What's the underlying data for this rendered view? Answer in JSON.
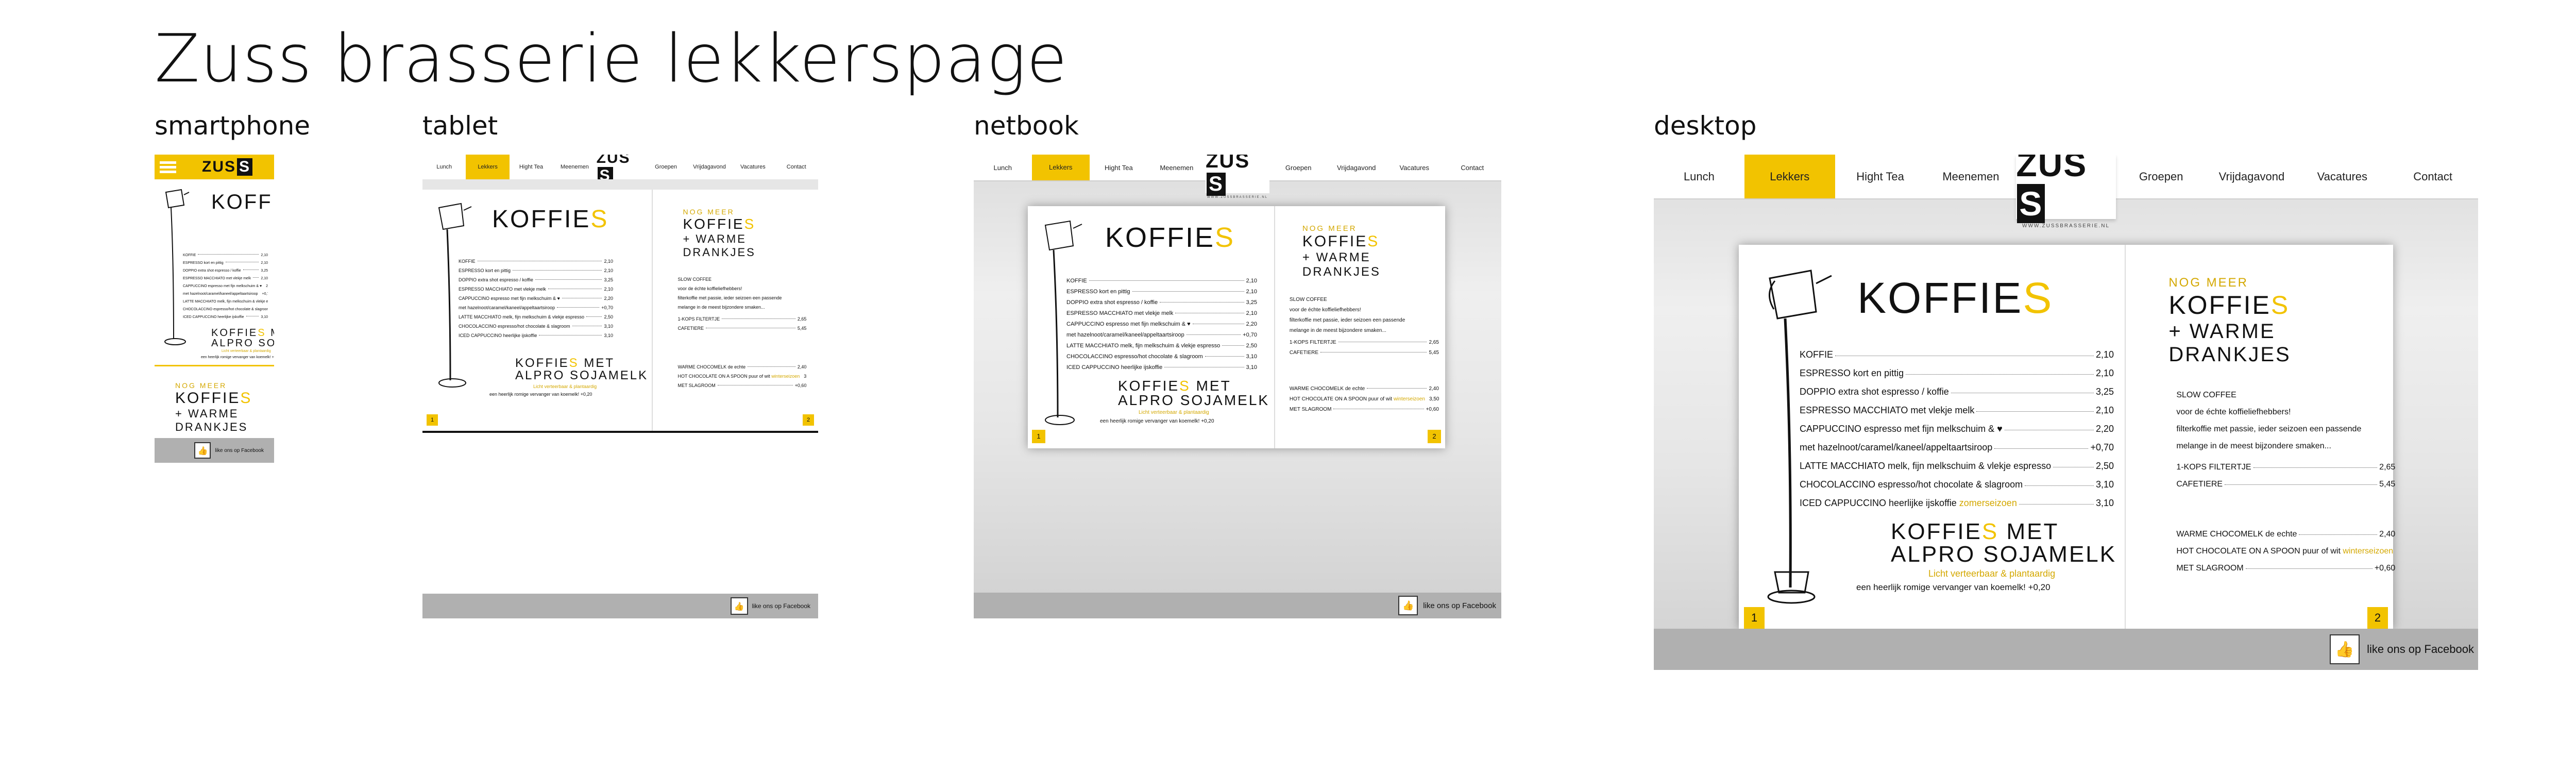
{
  "title": "Zuss brasserie lekkerspage",
  "labels": {
    "smartphone": "smartphone",
    "tablet": "tablet",
    "netbook": "netbook",
    "desktop": "desktop"
  },
  "nav": {
    "items": [
      "Lunch",
      "Lekkers",
      "Hight Tea",
      "Meenemen",
      "Groepen",
      "Vrijdagavond",
      "Vacatures",
      "Contact"
    ],
    "active": "Lekkers"
  },
  "logo": {
    "text": "ZUS",
    "mark": "S",
    "sub": "WWW.ZUSSBRASSERIE.NL"
  },
  "menu": {
    "koffie_heading_a": "KOFFIE",
    "koffie_heading_b": "S",
    "items": [
      {
        "name": "KOFFIE",
        "price": "2,10"
      },
      {
        "name": "ESPRESSO kort en pittig",
        "price": "2,10"
      },
      {
        "name": "DOPPIO extra shot espresso / koffie",
        "price": "3,25"
      },
      {
        "name": "ESPRESSO MACCHIATO met vlekje melk",
        "price": "2,10"
      },
      {
        "name": "CAPPUCCINO espresso met fijn melkschuim & ♥",
        "price": "2,20"
      },
      {
        "name": "met hazelnoot/caramel/kaneel/appeltaartsiroop",
        "price": "+0,70"
      },
      {
        "name": "LATTE MACCHIATO melk, fijn melkschuim & vlekje espresso",
        "price": "2,50"
      },
      {
        "name": "CHOCOLACCINO espresso/hot chocolate & slagroom",
        "price": "3,10"
      },
      {
        "name": "ICED CAPPUCCINO heerlijke ijskoffie",
        "price": "3,10",
        "extra": "zomerseizoen"
      }
    ],
    "alpro_heading_1a": "KOFFIE",
    "alpro_heading_1b": "S",
    "alpro_heading_1c": " MET",
    "alpro_heading_2": "ALPRO SOJAMELK",
    "alpro_sub": "Licht verteerbaar & plantaardig",
    "alpro_line": "een heerlijk romige vervanger van koemelk!",
    "alpro_price": "+0,20",
    "right_heading_1": "NOG MEER",
    "right_heading_2a": "KOFFIE",
    "right_heading_2b": "S",
    "right_heading_3": "+ WARME",
    "right_heading_4": "DRANKJES",
    "slow_title": "SLOW COFFEE",
    "slow_lines": [
      "voor de échte koffieliefhebbers!",
      "filterkoffie met passie, ieder seizoen een passende",
      "melange in de meest bijzondere smaken..."
    ],
    "right_items_a": [
      {
        "name": "1-KOPS FILTERTJE",
        "price": "2,65"
      },
      {
        "name": "CAFETIERE",
        "price": "5,45"
      }
    ],
    "right_items_b": [
      {
        "name": "WARME CHOCOMELK de echte",
        "price": "2,40"
      },
      {
        "name": "HOT CHOCOLATE ON A SPOON puur of wit",
        "price": "3,50",
        "extra": "winterseizoen"
      },
      {
        "name": "MET SLAGROOM",
        "price": "+0,60"
      }
    ],
    "page_left": "1",
    "page_right": "2"
  },
  "facebook": {
    "text": "like ons op Facebook"
  }
}
